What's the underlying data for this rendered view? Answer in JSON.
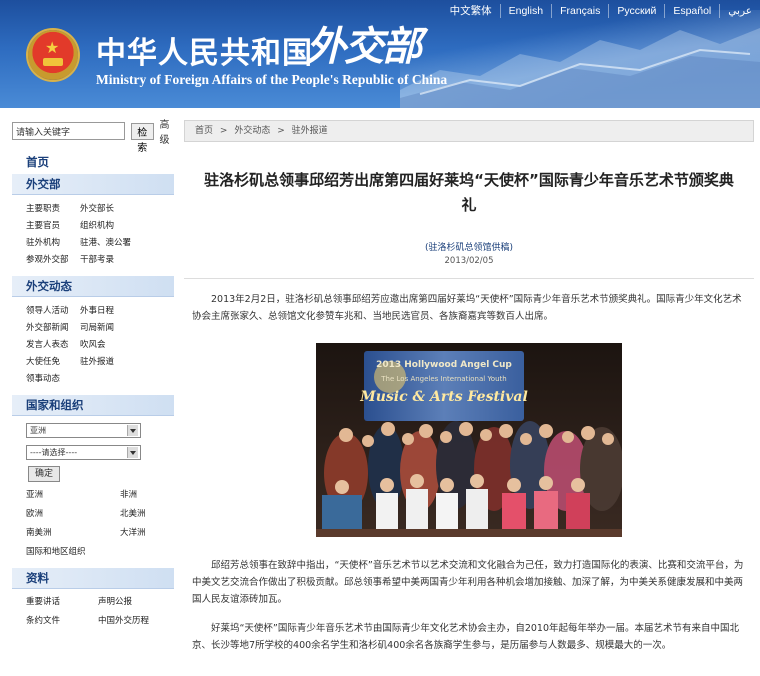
{
  "header": {
    "title_cn": "中华人民共和国",
    "title_big": "外交部",
    "title_en": "Ministry of Foreign Affairs of the People's Republic of China",
    "languages": [
      "中文繁体",
      "English",
      "Français",
      "Русский",
      "Español",
      "عربي"
    ]
  },
  "sidebar": {
    "search_placeholder": "请输入关键字",
    "search_button": "检索",
    "advanced": "高级",
    "home": "首页",
    "section1": {
      "title": "外交部",
      "items": [
        "主要职责",
        "外交部长",
        "主要官员",
        "组织机构",
        "驻外机构",
        "驻港、澳公署",
        "参观外交部",
        "干部考录"
      ]
    },
    "section2": {
      "title": "外交动态",
      "items": [
        "领导人活动",
        "外事日程",
        "外交部新闻",
        "司局新闻",
        "发言人表态",
        "吹风会",
        "大使任免",
        "驻外报道",
        "领事动态"
      ]
    },
    "section3": {
      "title": "国家和组织",
      "select1": "亚洲",
      "select2": "----请选择----",
      "ok": "确定",
      "regions": [
        "亚洲",
        "非洲",
        "欧洲",
        "北美洲",
        "南美洲",
        "大洋洲",
        "国际和地区组织"
      ]
    },
    "section4": {
      "title": "资料",
      "items": [
        "重要讲话",
        "声明公报",
        "条约文件",
        "中国外交历程"
      ]
    }
  },
  "main": {
    "breadcrumb": [
      "首页",
      ">",
      "外交动态",
      ">",
      "驻外报道"
    ],
    "title": "驻洛杉矶总领事邱绍芳出席第四届好莱坞“天使杯”国际青少年音乐艺术节颁奖典礼",
    "source": "(驻洛杉矶总领馆供稿)",
    "date": "2013/02/05",
    "para1": "2013年2月2日，驻洛杉矶总领事邱绍芳应邀出席第四届好莱坞“天使杯”国际青少年音乐艺术节颁奖典礼。国际青少年文化艺术协会主席张家久、总领馆文化参赞车兆和、当地民选官员、各族裔嘉宾等数百人出席。",
    "photo_banner": [
      "2013 Hollywood Angel Cup",
      "The Los Angeles International Youth",
      "Music & Arts Festival"
    ],
    "para2": "邱绍芳总领事在致辞中指出，“天使杯”音乐艺术节以艺术交流和文化融合为己任，致力打造国际化的表演、比赛和交流平台，为中美文艺交流合作做出了积极贡献。邱总领事希望中美两国青少年利用各种机会增加接触、加深了解，为中美关系健康发展和中美两国人民友谊添砖加瓦。",
    "para3": "好莱坞“天使杯”国际青少年音乐艺术节由国际青少年文化艺术协会主办，自2010年起每年举办一届。本届艺术节有来自中国北京、长沙等地7所学校的400余名学生和洛杉矶400余名各族裔学生参与，是历届参与人数最多、规模最大的一次。"
  },
  "colors": {
    "header_blue": "#2e6cc0",
    "nav_blue": "#1a3f7a"
  }
}
